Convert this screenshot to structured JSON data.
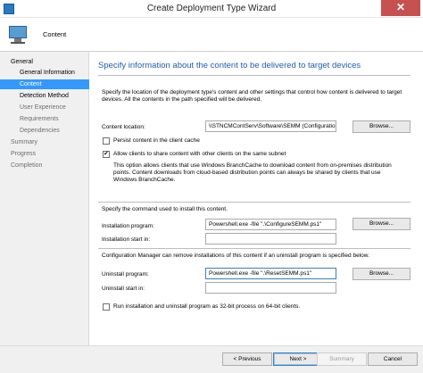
{
  "window": {
    "title": "Create Deployment Type Wizard",
    "close_symbol": "✕"
  },
  "header": {
    "title": "Content"
  },
  "nav": {
    "items": [
      {
        "label": "General"
      },
      {
        "label": "General Information"
      },
      {
        "label": "Content"
      },
      {
        "label": "Detection Method"
      },
      {
        "label": "User Experience"
      },
      {
        "label": "Requirements"
      },
      {
        "label": "Dependencies"
      },
      {
        "label": "Summary"
      },
      {
        "label": "Progress"
      },
      {
        "label": "Completion"
      }
    ]
  },
  "main": {
    "heading": "Specify information about the content to be delivered to target devices",
    "intro": "Specify the location of the deployment type's content and other settings that control how content is delivered to target devices. All the contents in the path specified will be delivered.",
    "content_location": {
      "label": "Content location:",
      "value": "\\\\STNCMContServ\\Software\\SEMM (Configuratio"
    },
    "persist_cache": {
      "label": "Persist content in the client cache",
      "checked": false
    },
    "allow_share": {
      "label": "Allow clients to share content with other clients on the same subnet",
      "checked": true
    },
    "branchcache_note": "This option allows clients that use Windows BranchCache to download content from on-premises distribution points. Content downloads from cloud-based distribution points can always be shared by clients that use Windows BranchCache.",
    "install_section_text": "Specify the command used to install this content.",
    "installation_program": {
      "label": "Installation program:",
      "value": "Powershell.exe -file \".\\ConfigureSEMM.ps1\""
    },
    "installation_start_in": {
      "label": "Installation start in:",
      "value": ""
    },
    "uninstall_section_text": "Configuration Manager can remove installations of this content if an uninstall program is specified below.",
    "uninstall_program": {
      "label": "Uninstall program:",
      "value": "Powershell.exe -file \".\\ResetSEMM.ps1\""
    },
    "uninstall_start_in": {
      "label": "Uninstall start in:",
      "value": ""
    },
    "run_32bit": {
      "label": "Run installation and uninstall program as 32-bit process on 64-bit clients.",
      "checked": false
    },
    "browse_label": "Browse..."
  },
  "footer": {
    "previous": "< Previous",
    "next": "Next >",
    "summary": "Summary",
    "cancel": "Cancel"
  }
}
